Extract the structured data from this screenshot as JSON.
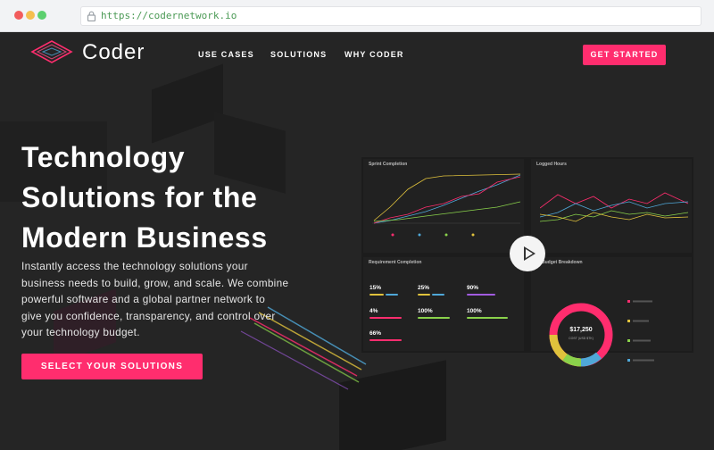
{
  "browser": {
    "url": "https://codernetwork.io"
  },
  "header": {
    "brand": "Coder",
    "nav": [
      "USE CASES",
      "SOLUTIONS",
      "WHY CODER"
    ],
    "cta": "GET STARTED"
  },
  "hero": {
    "title_lines": [
      "Technology",
      "Solutions for the",
      "Modern Business"
    ],
    "body_lines": [
      "Instantly access the technology solutions your",
      "business needs to build, grow, and scale. We combine",
      "powerful software and a global partner network to",
      "give you confidence, transparency, and control over",
      "your technology budget."
    ],
    "cta": "SELECT YOUR SOLUTIONS"
  },
  "dashboard": {
    "sprint_title": "Sprint Completion",
    "hours_title": "Logged Hours",
    "req_title": "Requirement Completion",
    "budget_title": "Budget Breakdown",
    "stats": [
      "15%",
      "25%",
      "90%",
      "4%",
      "100%",
      "100%",
      "66%"
    ],
    "donut_amount": "$17,250",
    "donut_label": "COST (USD $TK)"
  },
  "colors": {
    "accent": "#ff2d6e",
    "yellow": "#e0c23c",
    "blue": "#4fa8d8",
    "green": "#8ad24b",
    "red": "#e8405c"
  }
}
